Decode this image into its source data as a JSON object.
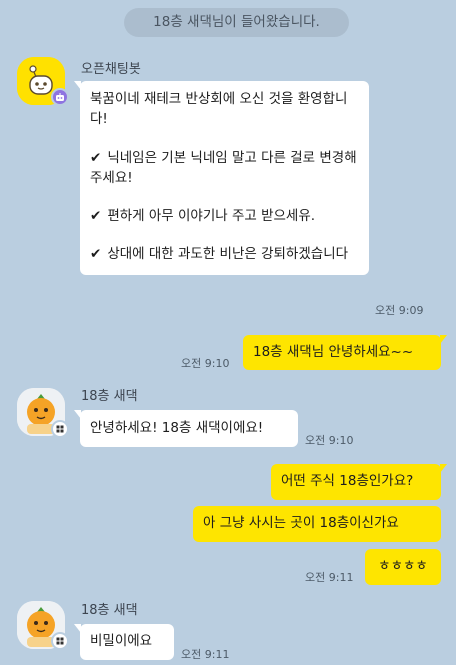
{
  "system_notice": "18층 새댁님이 들어왔습니다.",
  "bot": {
    "name": "오픈채팅봇",
    "welcome": {
      "intro": "북꿈이네 재테크 반상회에 오신 것을 환영합니다!",
      "rule1": "닉네임은 기본 닉네임 말고 다른 걸로 변경해주세요!",
      "rule2": "편하게 아무 이야기나 주고 받으세유.",
      "rule3": "상대에 대한 과도한 비난은 강퇴하겠습니다",
      "check_glyph": "✔"
    },
    "time": "오전 9:09"
  },
  "messages": {
    "out1": {
      "text": "18층 새댁님 안녕하세요~~",
      "time": "오전 9:10"
    },
    "user_name": "18층 새댁",
    "in1": {
      "text": "안녕하세요! 18층 새댁이에요!",
      "time": "오전 9:10"
    },
    "out2": {
      "text": "어떤 주식 18층인가요?"
    },
    "out3": {
      "text": "아 그냥 사시는 곳이 18층이신가요"
    },
    "out4": {
      "text": "ㅎㅎㅎㅎ",
      "time": "오전 9:11"
    },
    "user_name2": "18층 새댁",
    "in2": {
      "text": "비밀이에요",
      "time": "오전 9:11"
    }
  },
  "colors": {
    "background": "#bacee0",
    "incoming_bubble": "#ffffff",
    "outgoing_bubble": "#fee500",
    "bot_avatar": "#ffe100",
    "bot_badge": "#8e74e0"
  },
  "icons": {
    "bot_avatar": "chatbot-mascot-icon",
    "bot_badge": "robot-badge-icon",
    "user_avatar": "orange-mascot-avatar",
    "user_badge": "open-chat-badge-icon"
  }
}
